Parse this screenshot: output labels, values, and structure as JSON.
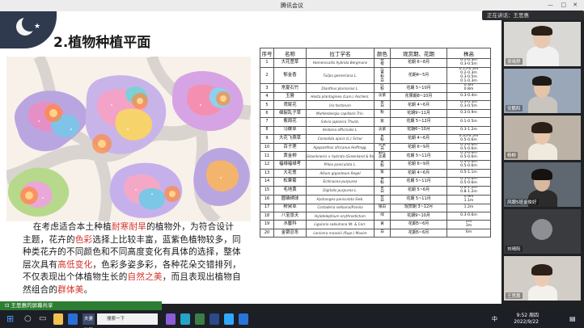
{
  "window": {
    "title": "腾讯会议",
    "speaking_label": "正在讲话：王思惠",
    "share_label": "王思惠的屏幕共享"
  },
  "slide": {
    "title": "2.植物种植平面",
    "paragraph": [
      {
        "t": "在考虑适合本土种植"
      },
      {
        "t": "耐寒耐旱",
        "hl": true
      },
      {
        "t": "的植物外，为符合设计主题，花卉的"
      },
      {
        "t": "色彩",
        "hl": true
      },
      {
        "t": "选择上比较丰富，蓝紫色植物较多，同种类花卉的不同颜色和不同高度变化有具体的选择，整体层次具有"
      },
      {
        "t": "高低变化",
        "hl": true
      },
      {
        "t": "，色彩多姿多彩，各种花朵交错排列，不仅表现出个体植物生长的"
      },
      {
        "t": "自然之美",
        "hl": true
      },
      {
        "t": "，而且表现出植物自然组合的"
      },
      {
        "t": "群体美",
        "hl": true
      },
      {
        "t": "。"
      }
    ],
    "table": {
      "headers": [
        "序号",
        "名称",
        "拉丁学名",
        "颜色",
        "观赏期、花期",
        "株高"
      ],
      "rows": [
        {
          "no": "1",
          "name": "大花萱草",
          "latin": "Hemerocallis hybrida Bergmans",
          "colors": [
            "粉",
            "橙"
          ],
          "period": "花期 6~8月",
          "heights": [
            "0.1-0.3m",
            "0.3-0.5m"
          ]
        },
        {
          "no": "2",
          "name": "郁金香",
          "latin": "Tulipa gesneriana L.",
          "colors": [
            "红",
            "黄",
            "粉",
            "白"
          ],
          "period": "花期4~5月",
          "heights": [
            "0.15-0.3m",
            "0.2-0.3m",
            "0.3-0.5m",
            "0.1-0.3m"
          ]
        },
        {
          "no": "3",
          "name": "常夏石竹",
          "latin": "Dianthus plumarius L.",
          "colors": [
            "红",
            "粉"
          ],
          "period": "花期 5~10月",
          "heights": [
            "0.3m",
            "0.8m"
          ]
        },
        {
          "no": "4",
          "name": "玉簪",
          "latin": "Hosta plantaginea (Lam.) Aschers.",
          "colors": [
            "淡紫"
          ],
          "period": "花果期8~10月",
          "heights": [
            "0.3-0.4m"
          ]
        },
        {
          "no": "5",
          "name": "鸢尾花",
          "latin": "Iris tectorum",
          "colors": [
            "紫",
            "白"
          ],
          "period": "花期 4~6月",
          "heights": [
            "0.3-0.5m",
            "0.3-0.5m"
          ]
        },
        {
          "no": "6",
          "name": "细裂乱子草",
          "latin": "Muhlenbergia capillaris Trin.",
          "colors": [
            "粉"
          ],
          "period": "花期9~11月",
          "heights": [
            "0.3-0.9m"
          ]
        },
        {
          "no": "7",
          "name": "紫周花",
          "latin": "Salvia japonica Thunb.",
          "colors": [
            "紫"
          ],
          "period": "花期 5~12月",
          "heights": [
            "0.1-0.5m"
          ]
        },
        {
          "no": "8",
          "name": "马鞭草",
          "latin": "Verbena officinalis L.",
          "colors": [
            "淡紫"
          ],
          "period": "花期6~10月",
          "heights": [
            "0.3-1.2m"
          ]
        },
        {
          "no": "9",
          "name": "大花飞燕草",
          "latin": "Consolida ajacis (L.) Schur",
          "colors": [
            "紫",
            "粉"
          ],
          "period": "花期 4~6月",
          "heights": [
            "0.35-0.5m",
            "0.5-0.6m"
          ]
        },
        {
          "no": "10",
          "name": "百子莲",
          "latin": "Agapanthus africanus Hoffmgg.",
          "colors": [
            "淡紫",
            "白"
          ],
          "period": "花期 6~9月",
          "heights": [
            "0.5-0.6m",
            "0.5-0.6m"
          ]
        },
        {
          "no": "11",
          "name": "黄金柳",
          "latin": "Gloeckneria × hybrida (Greenland & Roundm) ... L. Nelson & Fruski",
          "colors": [
            "翻红",
            "淡黄"
          ],
          "period": "花期 5~11月",
          "heights": [
            "0.5-0.6m",
            "0.5-0.6m"
          ]
        },
        {
          "no": "12",
          "name": "福禄福禄考",
          "latin": "Phlox paniculata L.",
          "colors": [
            "紫",
            "粉"
          ],
          "period": "花期 6~9月",
          "heights": [
            "0.4-0.6m",
            "0.5-0.6m"
          ]
        },
        {
          "no": "13",
          "name": "大花葱",
          "latin": "Allium giganteum Regel",
          "colors": [
            "紫"
          ],
          "period": "花期 4~6月",
          "heights": [
            "0.5-1.1m"
          ]
        },
        {
          "no": "14",
          "name": "松果菊",
          "latin": "Echinacea purpurea",
          "colors": [
            "黄",
            "粉"
          ],
          "period": "花期 5~11月",
          "heights": [
            "0.5-0.6m",
            "0.5-0.6m"
          ]
        },
        {
          "no": "15",
          "name": "毛地黄",
          "latin": "Digitalis purpurea L.",
          "colors": [
            "紫",
            "白"
          ],
          "period": "花期 5~6月",
          "heights": [
            "0.6-1.2m",
            "0.8-1.2m"
          ]
        },
        {
          "no": "16",
          "name": "圆锥绣球",
          "latin": "Hydrangea paniculata Sieb.",
          "colors": [
            "粉",
            "白"
          ],
          "period": "花期 5~11月",
          "heights": [
            "0.9m",
            "1.1m"
          ]
        },
        {
          "no": "17",
          "name": "粉黛草",
          "latin": "Cortaderia selloana/Pamila",
          "colors": [
            "银白"
          ],
          "period": "观赏期 3~12月",
          "heights": [
            "1.2m"
          ]
        },
        {
          "no": "18",
          "name": "八宝景天",
          "latin": "Hylotelephium erythrostictum",
          "colors": [
            "绿"
          ],
          "period": "花期9~10月",
          "heights": [
            "0.3-0.6m"
          ]
        },
        {
          "no": "19",
          "name": "水鳖科",
          "latin": "Ligularia sabiuhana Nt. & Corr.",
          "colors": [
            "黄"
          ],
          "period": "花期5~6月",
          "heights": [
            "2m",
            "3m"
          ]
        },
        {
          "no": "20",
          "name": "金银忍冬",
          "latin": "Lonicera maackii (Rupr.) Maxim",
          "colors": [
            "白"
          ],
          "period": "花期5~6月",
          "heights": [
            "6m"
          ]
        }
      ]
    }
  },
  "participants": [
    {
      "name": "吴晓舒"
    },
    {
      "name": "安鹏阳"
    },
    {
      "name": "杨柳"
    },
    {
      "name": "风眼5班金俊好"
    },
    {
      "name": "刘晴阳"
    },
    {
      "name": "王思惠"
    }
  ],
  "taskbar": {
    "search_placeholder": "搜索一下",
    "search_tab": "夫妻吵架双双...",
    "time": "9:52 周四",
    "date": "2022/9/22",
    "ime": "中"
  },
  "colors": {
    "highlight": "#d3322b",
    "share_bar": "#2d7d32"
  }
}
